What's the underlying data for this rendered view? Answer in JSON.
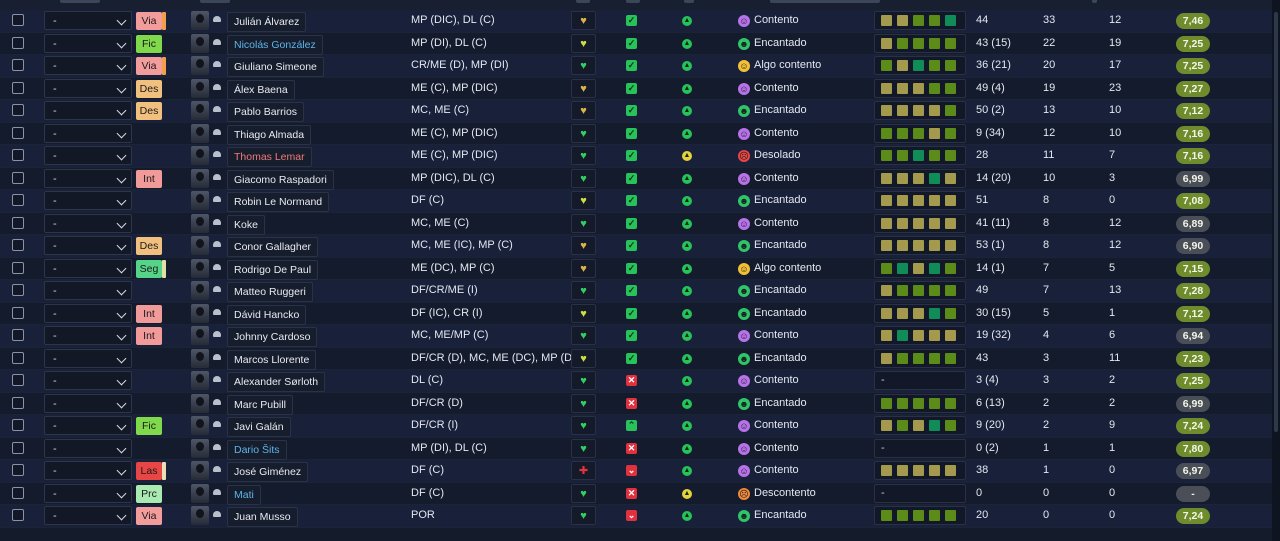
{
  "colors": {
    "background": "#141b2b",
    "rating_green": "#6f8c2c",
    "rating_grey": "#4a4e57",
    "form_olive": "#a39a4e",
    "form_green": "#5b8c1a",
    "form_teal": "#0f8c58"
  },
  "roles": {
    "Via": {
      "bg": "#f39c9c",
      "stub": "#f0a04a"
    },
    "Fic": {
      "bg": "#7fd94a",
      "stub": null
    },
    "Des": {
      "bg": "#f1c07f",
      "stub": null
    },
    "Int": {
      "bg": "#f09a9a",
      "stub": null
    },
    "Seg": {
      "bg": "#55d489",
      "stub": "#e0e0a8"
    },
    "Las": {
      "bg": "#e84545",
      "stub": "#e8dfb8"
    },
    "Prc": {
      "bg": "#a9eab3",
      "stub": null
    }
  },
  "morale_styles": {
    "Contento": {
      "bg": "#b772e9",
      "glyph": "☺"
    },
    "Encantado": {
      "bg": "#2ec56a",
      "glyph": "☻"
    },
    "Algo contento": {
      "bg": "#f2c037",
      "glyph": "☺"
    },
    "Desolado": {
      "bg": "#e84545",
      "glyph": "☹"
    },
    "Descontento": {
      "bg": "#f08a3a",
      "glyph": "☹"
    }
  },
  "fitness_styles": {
    "heart-green": {
      "color": "#33cf62"
    },
    "heart-gold": {
      "color": "#dcb347"
    },
    "heart-yellow": {
      "color": "#cddc3e"
    },
    "injury": {
      "color": "#e3343f"
    }
  },
  "rows": [
    {
      "select": "-",
      "role": "Via",
      "role_stub": true,
      "name": "Julián Álvarez",
      "name_color": "",
      "position": "MP (DIC), DL (C)",
      "fitness": "heart-gold",
      "available": "ok",
      "dot": "green",
      "morale": "Contento",
      "form": [
        "olive",
        "olive",
        "green",
        "green",
        "teal"
      ],
      "apps": "44",
      "goals": "33",
      "assists": "12",
      "rating": "7,46"
    },
    {
      "select": "-",
      "role": "Fic",
      "role_stub": false,
      "name": "Nicolás González",
      "name_color": "blue",
      "position": "MP (DI), DL (C)",
      "fitness": "heart-yellow",
      "available": "ok",
      "dot": "green",
      "morale": "Encantado",
      "form": [
        "olive",
        "green",
        "green",
        "green",
        "green"
      ],
      "apps": "43 (15)",
      "goals": "22",
      "assists": "19",
      "rating": "7,25"
    },
    {
      "select": "-",
      "role": "Via",
      "role_stub": true,
      "name": "Giuliano Simeone",
      "name_color": "",
      "position": "CR/ME (D), MP (DI)",
      "fitness": "heart-green",
      "available": "ok",
      "dot": "green",
      "morale": "Algo contento",
      "form": [
        "green",
        "olive",
        "teal",
        "green",
        "green"
      ],
      "apps": "36 (21)",
      "goals": "20",
      "assists": "17",
      "rating": "7,25"
    },
    {
      "select": "-",
      "role": "Des",
      "role_stub": false,
      "name": "Álex Baena",
      "name_color": "",
      "position": "ME (C), MP (DIC)",
      "fitness": "heart-gold",
      "available": "ok",
      "dot": "green",
      "morale": "Contento",
      "form": [
        "olive",
        "olive",
        "olive",
        "green",
        "green"
      ],
      "apps": "49 (4)",
      "goals": "19",
      "assists": "23",
      "rating": "7,27"
    },
    {
      "select": "-",
      "role": "Des",
      "role_stub": false,
      "name": "Pablo Barrios",
      "name_color": "",
      "position": "MC, ME (C)",
      "fitness": "heart-gold",
      "available": "ok",
      "dot": "green",
      "morale": "Encantado",
      "form": [
        "olive",
        "olive",
        "olive",
        "olive",
        "green"
      ],
      "apps": "50 (2)",
      "goals": "13",
      "assists": "10",
      "rating": "7,12"
    },
    {
      "select": "-",
      "role": "",
      "role_stub": false,
      "name": "Thiago Almada",
      "name_color": "",
      "position": "ME (C), MP (DIC)",
      "fitness": "heart-green",
      "available": "ok",
      "dot": "green",
      "morale": "Contento",
      "form": [
        "green",
        "green",
        "green",
        "olive",
        "green"
      ],
      "apps": "9 (34)",
      "goals": "12",
      "assists": "10",
      "rating": "7,16"
    },
    {
      "select": "-",
      "role": "",
      "role_stub": false,
      "name": "Thomas Lemar",
      "name_color": "red",
      "position": "ME (C), MP (DIC)",
      "fitness": "heart-green",
      "available": "ok",
      "dot": "yellow",
      "morale": "Desolado",
      "form": [
        "green",
        "green",
        "teal",
        "green",
        "green"
      ],
      "apps": "28",
      "goals": "11",
      "assists": "7",
      "rating": "7,16"
    },
    {
      "select": "-",
      "role": "Int",
      "role_stub": false,
      "name": "Giacomo Raspadori",
      "name_color": "",
      "position": "MP (DIC), DL (C)",
      "fitness": "heart-green",
      "available": "ok",
      "dot": "green",
      "morale": "Contento",
      "form": [
        "olive",
        "olive",
        "olive",
        "teal",
        "olive"
      ],
      "apps": "14 (20)",
      "goals": "10",
      "assists": "3",
      "rating": "6,99"
    },
    {
      "select": "-",
      "role": "",
      "role_stub": false,
      "name": "Robin Le Normand",
      "name_color": "",
      "position": "DF (C)",
      "fitness": "heart-yellow",
      "available": "ok",
      "dot": "green",
      "morale": "Encantado",
      "form": [
        "olive",
        "olive",
        "olive",
        "olive",
        "olive"
      ],
      "apps": "51",
      "goals": "8",
      "assists": "0",
      "rating": "7,08"
    },
    {
      "select": "-",
      "role": "",
      "role_stub": false,
      "name": "Koke",
      "name_color": "",
      "position": "MC, ME (C)",
      "fitness": "heart-green",
      "available": "ok",
      "dot": "green",
      "morale": "Contento",
      "form": [
        "olive",
        "olive",
        "olive",
        "olive",
        "olive"
      ],
      "apps": "41 (11)",
      "goals": "8",
      "assists": "12",
      "rating": "6,89"
    },
    {
      "select": "-",
      "role": "Des",
      "role_stub": false,
      "name": "Conor Gallagher",
      "name_color": "",
      "position": "MC, ME (IC), MP (C)",
      "fitness": "heart-gold",
      "available": "ok",
      "dot": "green",
      "morale": "Encantado",
      "form": [
        "olive",
        "olive",
        "olive",
        "olive",
        "olive"
      ],
      "apps": "53 (1)",
      "goals": "8",
      "assists": "12",
      "rating": "6,90"
    },
    {
      "select": "-",
      "role": "Seg",
      "role_stub": true,
      "name": "Rodrigo De Paul",
      "name_color": "",
      "position": "ME (DC), MP (C)",
      "fitness": "heart-gold",
      "available": "ok",
      "dot": "green",
      "morale": "Algo contento",
      "form": [
        "green",
        "teal",
        "olive",
        "teal",
        "green"
      ],
      "apps": "14 (1)",
      "goals": "7",
      "assists": "5",
      "rating": "7,15"
    },
    {
      "select": "-",
      "role": "",
      "role_stub": false,
      "name": "Matteo Ruggeri",
      "name_color": "",
      "position": "DF/CR/ME (I)",
      "fitness": "heart-green",
      "available": "ok",
      "dot": "green",
      "morale": "Encantado",
      "form": [
        "olive",
        "green",
        "green",
        "green",
        "green"
      ],
      "apps": "49",
      "goals": "7",
      "assists": "13",
      "rating": "7,28"
    },
    {
      "select": "-",
      "role": "Int",
      "role_stub": false,
      "name": "Dávid Hancko",
      "name_color": "",
      "position": "DF (IC), CR (I)",
      "fitness": "heart-yellow",
      "available": "ok",
      "dot": "green",
      "morale": "Encantado",
      "form": [
        "olive",
        "olive",
        "olive",
        "teal",
        "green"
      ],
      "apps": "30 (15)",
      "goals": "5",
      "assists": "1",
      "rating": "7,12"
    },
    {
      "select": "-",
      "role": "Int",
      "role_stub": false,
      "name": "Johnny Cardoso",
      "name_color": "",
      "position": "MC, ME/MP (C)",
      "fitness": "heart-green",
      "available": "ok",
      "dot": "green",
      "morale": "Contento",
      "form": [
        "olive",
        "teal",
        "olive",
        "olive",
        "olive"
      ],
      "apps": "19 (32)",
      "goals": "4",
      "assists": "6",
      "rating": "6,94"
    },
    {
      "select": "-",
      "role": "",
      "role_stub": false,
      "name": "Marcos Llorente",
      "name_color": "",
      "position": "DF/CR (D), MC, ME (DC), MP (D)",
      "fitness": "heart-yellow",
      "available": "ok",
      "dot": "green",
      "morale": "Encantado",
      "form": [
        "olive",
        "green",
        "green",
        "green",
        "green"
      ],
      "apps": "43",
      "goals": "3",
      "assists": "11",
      "rating": "7,23"
    },
    {
      "select": "-",
      "role": "",
      "role_stub": false,
      "name": "Alexander Sørloth",
      "name_color": "",
      "position": "DL (C)",
      "fitness": "heart-green",
      "available": "no",
      "dot": "green",
      "morale": "Contento",
      "form": [],
      "apps": "3 (4)",
      "goals": "3",
      "assists": "2",
      "rating": "7,25"
    },
    {
      "select": "-",
      "role": "",
      "role_stub": false,
      "name": "Marc Pubill",
      "name_color": "",
      "position": "DF/CR (D)",
      "fitness": "heart-green",
      "available": "no",
      "dot": "green",
      "morale": "Encantado",
      "form": [
        "green",
        "green",
        "green",
        "green",
        "green"
      ],
      "apps": "6 (13)",
      "goals": "2",
      "assists": "2",
      "rating": "6,99"
    },
    {
      "select": "-",
      "role": "Fic",
      "role_stub": false,
      "name": "Javi Galán",
      "name_color": "",
      "position": "DF/CR (I)",
      "fitness": "heart-green",
      "available": "up",
      "dot": "green",
      "morale": "Contento",
      "form": [
        "olive",
        "green",
        "olive",
        "teal",
        "green"
      ],
      "apps": "9 (20)",
      "goals": "2",
      "assists": "9",
      "rating": "7,24"
    },
    {
      "select": "-",
      "role": "",
      "role_stub": false,
      "name": "Dario Šits",
      "name_color": "blue",
      "position": "MP (DI), DL (C)",
      "fitness": "heart-green",
      "available": "no",
      "dot": "green",
      "morale": "Contento",
      "form": [],
      "apps": "0 (2)",
      "goals": "1",
      "assists": "1",
      "rating": "7,80"
    },
    {
      "select": "-",
      "role": "Las",
      "role_stub": true,
      "name": "José Giménez",
      "name_color": "",
      "position": "DF (C)",
      "fitness": "injury",
      "available": "down",
      "dot": "green",
      "morale": "Contento",
      "form": [
        "olive",
        "olive",
        "olive",
        "olive",
        "olive"
      ],
      "apps": "38",
      "goals": "1",
      "assists": "0",
      "rating": "6,97"
    },
    {
      "select": "-",
      "role": "Prc",
      "role_stub": false,
      "name": "Mati",
      "name_color": "blue",
      "position": "DF (C)",
      "fitness": "heart-green",
      "available": "no",
      "dot": "yellow",
      "morale": "Descontento",
      "form": [],
      "apps": "0",
      "goals": "0",
      "assists": "0",
      "rating": "-"
    },
    {
      "select": "-",
      "role": "Via",
      "role_stub": false,
      "name": "Juan Musso",
      "name_color": "",
      "position": "POR",
      "fitness": "heart-green",
      "available": "down",
      "dot": "green",
      "morale": "Encantado",
      "form": [
        "green",
        "green",
        "green",
        "green",
        "green"
      ],
      "apps": "20",
      "goals": "0",
      "assists": "0",
      "rating": "7,24"
    }
  ]
}
